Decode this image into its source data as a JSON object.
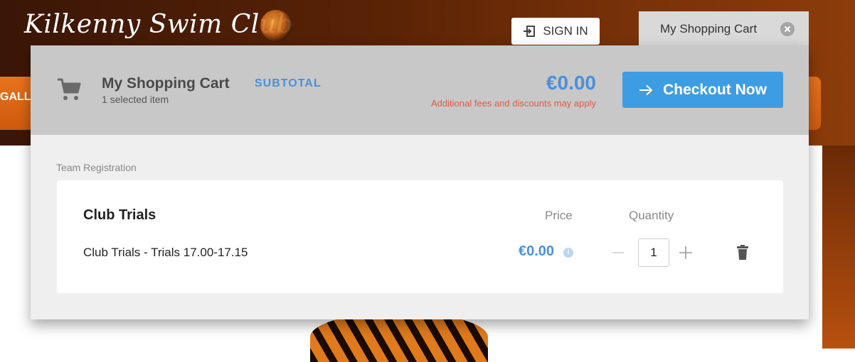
{
  "site": {
    "logo_text": "Kilkenny Swim Club",
    "nav_fragment": "GALL",
    "signin_label": "SIGN IN"
  },
  "cart_tab": {
    "label": "My Shopping Cart"
  },
  "cart": {
    "title": "My Shopping Cart",
    "selected_count": "1 selected item",
    "subtotal_label": "SUBTOTAL",
    "subtotal_amount": "€0.00",
    "fees_note": "Additional fees and discounts may apply",
    "checkout_label": "Checkout Now",
    "section_label": "Team Registration",
    "item": {
      "title": "Club Trials",
      "price_header": "Price",
      "quantity_header": "Quantity",
      "name": "Club Trials - Trials 17.00-17.15",
      "price": "€0.00",
      "quantity": "1"
    }
  },
  "icons": {
    "signin": "sign-in-icon",
    "close": "close-icon",
    "cart": "cart-icon",
    "arrow": "arrow-right-icon",
    "info": "info-icon",
    "minus": "minus-icon",
    "plus": "plus-icon",
    "trash": "trash-icon"
  },
  "colors": {
    "accent": "#3d9de2",
    "price_blue": "#4a90d9",
    "fees_red": "#e05a4a",
    "header_brown": "#5a2306",
    "nav_orange": "#e8731c"
  }
}
